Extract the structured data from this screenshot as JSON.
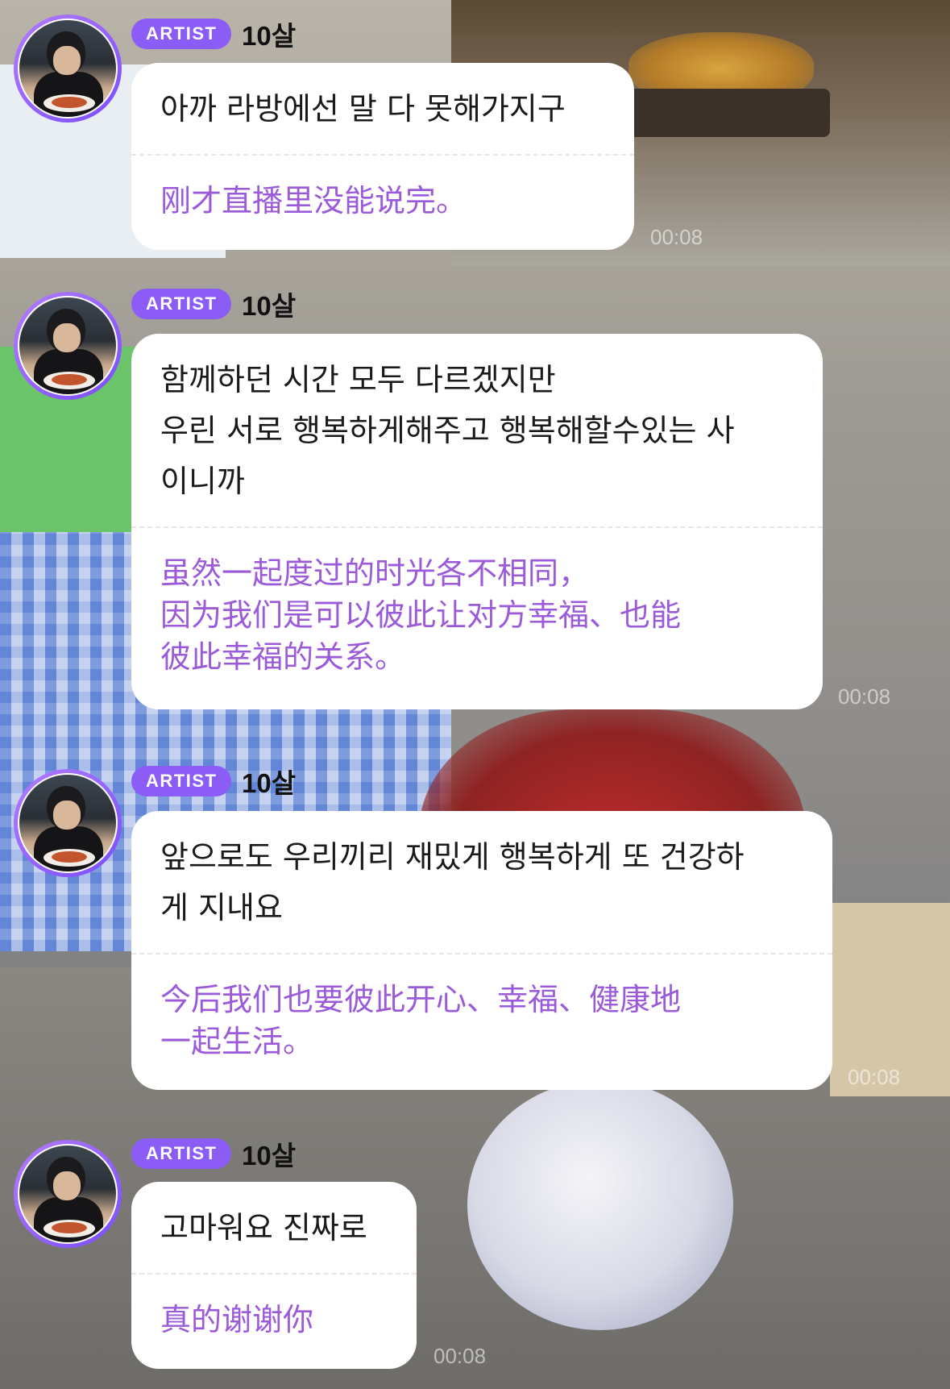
{
  "messages": [
    {
      "badge": "ARTIST",
      "sender": "10살",
      "original": "아까 라방에선 말 다 못해가지구",
      "translation": "刚才直播里没能说完。",
      "time": "00:08"
    },
    {
      "badge": "ARTIST",
      "sender": "10살",
      "original": "함께하던 시간 모두 다르겠지만\n우린 서로 행복하게해주고 행복해할수있는 사\n이니까",
      "translation": "虽然一起度过的时光各不相同，\n因为我们是可以彼此让对方幸福、也能\n彼此幸福的关系。",
      "time": "00:08"
    },
    {
      "badge": "ARTIST",
      "sender": "10살",
      "original": "앞으로도 우리끼리 재밌게 행복하게 또 건강하\n게 지내요",
      "translation": "今后我们也要彼此开心、幸福、健康地\n一起生活。",
      "time": "00:08"
    },
    {
      "badge": "ARTIST",
      "sender": "10살",
      "original": "고마워요 진짜로",
      "translation": "真的谢谢你",
      "time": "00:08"
    }
  ],
  "colors": {
    "badge": "#8b5cf6",
    "translation": "#9b5ad9",
    "avatar_ring": "#b37bff"
  }
}
